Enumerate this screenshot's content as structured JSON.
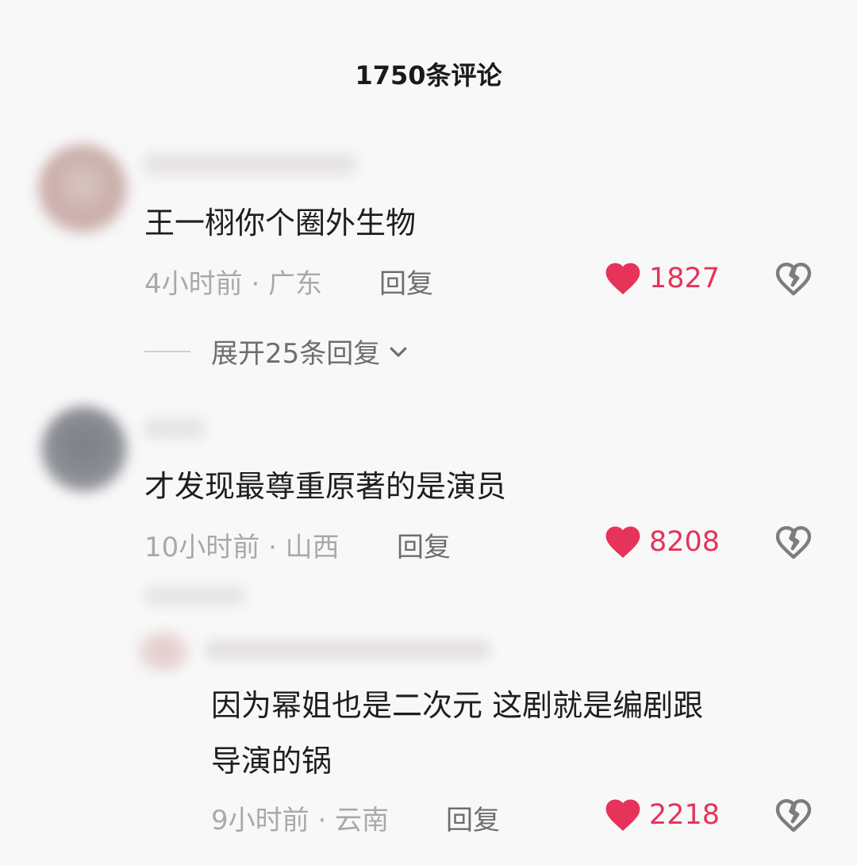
{
  "header": {
    "title": "1750条评论"
  },
  "colors": {
    "like_red": "#e6335a",
    "meta_gray": "#a9a9a9",
    "reply_gray": "#6e6e6e"
  },
  "comments": [
    {
      "text": "王一栩你个圈外生物",
      "time": "4小时前 · 广东",
      "reply_label": "回复",
      "likes": "1827",
      "expand_label": "展开25条回复"
    },
    {
      "text": "才发现最尊重原著的是演员",
      "time": "10小时前 · 山西",
      "reply_label": "回复",
      "likes": "8208"
    }
  ],
  "replies": [
    {
      "text_line1": "因为幂姐也是二次元 这剧就是编剧跟",
      "text_line2": "导演的锅",
      "time": "9小时前 · 云南",
      "reply_label": "回复",
      "likes": "2218"
    }
  ],
  "icons": {
    "like": "heart-filled-icon",
    "dislike": "broken-heart-icon",
    "expand": "chevron-down-icon"
  }
}
